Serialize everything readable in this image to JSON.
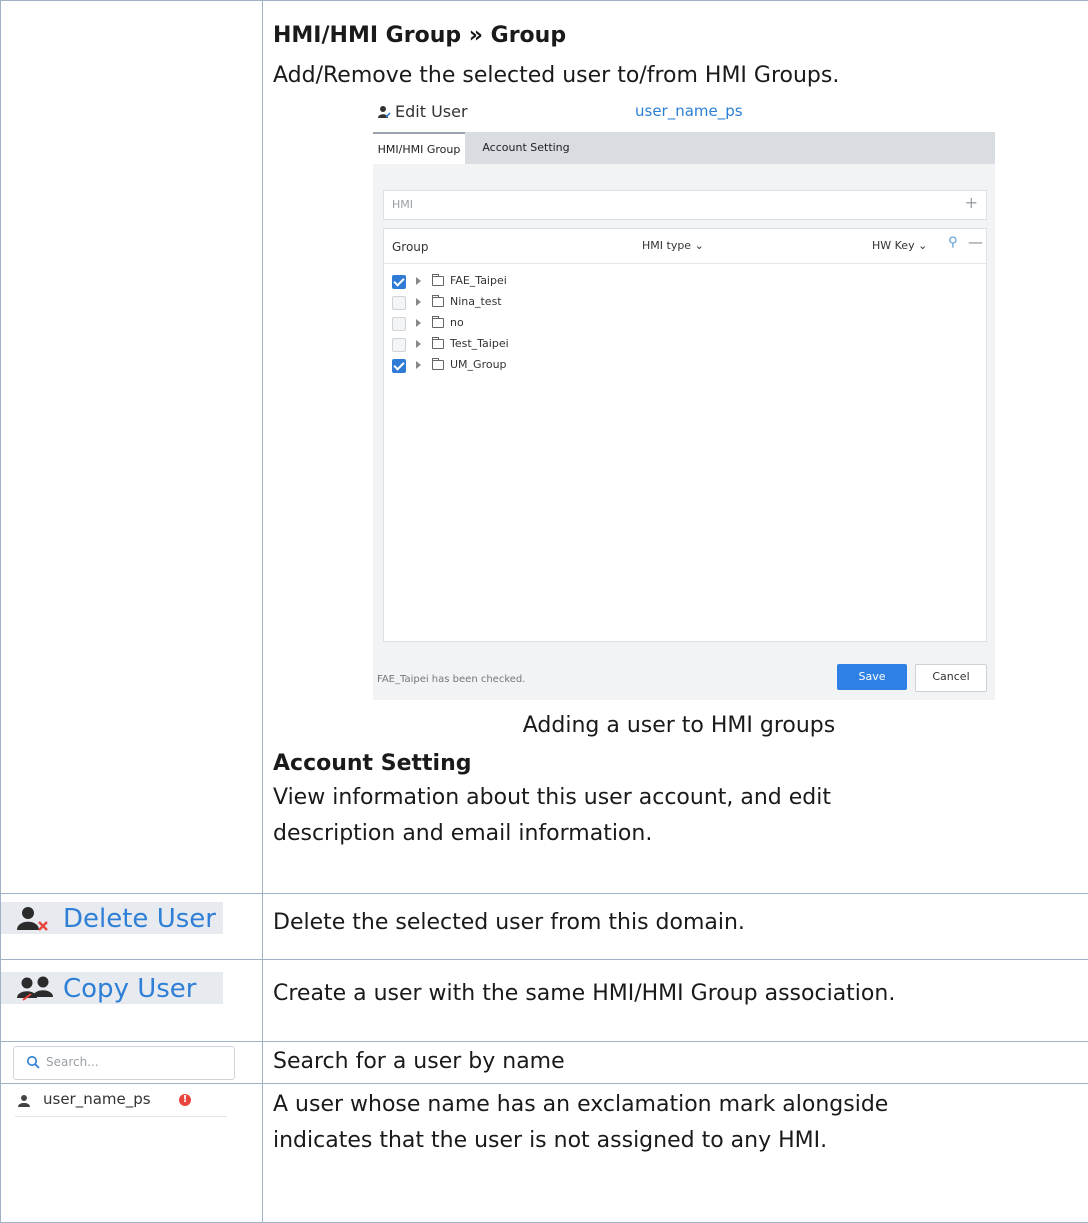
{
  "row1": {
    "heading": "HMI/HMI Group » Group",
    "description": "Add/Remove the selected user to/from HMI Groups.",
    "screenshot": {
      "title": "Edit User",
      "username": "user_name_ps",
      "tabs": [
        "HMI/HMI Group",
        "Account Setting"
      ],
      "hmi_label": "HMI",
      "hmi_add": "+",
      "columns": {
        "group": "Group",
        "hmi_type": "HMI type ⌄",
        "hw_key": "HW Key ⌄",
        "search": "⚲",
        "collapse": "—"
      },
      "groups": [
        {
          "name": "FAE_Taipei",
          "checked": true
        },
        {
          "name": "Nina_test",
          "checked": false
        },
        {
          "name": "no",
          "checked": false
        },
        {
          "name": "Test_Taipei",
          "checked": false
        },
        {
          "name": "UM_Group",
          "checked": true
        }
      ],
      "status": "FAE_Taipei has been checked.",
      "save_label": "Save",
      "cancel_label": "Cancel"
    },
    "caption": "Adding a user to HMI groups",
    "heading2": "Account Setting",
    "description2_line1": "View information about this user account, and edit",
    "description2_line2": "description and email information."
  },
  "row2": {
    "button_label": "Delete User",
    "description": "Delete the selected user from this domain."
  },
  "row3": {
    "button_label": "Copy User",
    "description": "Create a user with the same HMI/HMI Group association."
  },
  "row4": {
    "search_placeholder": "Search...",
    "description": "Search for a user by name"
  },
  "row5": {
    "user_name": "user_name_ps",
    "badge": "!",
    "description_line1": "A user whose name has an exclamation mark alongside",
    "description_line2": "indicates that the user is not assigned to any HMI."
  },
  "colors": {
    "border": "#9fb1c6",
    "accent": "#2f7fd6",
    "warning": "#e8453c"
  }
}
